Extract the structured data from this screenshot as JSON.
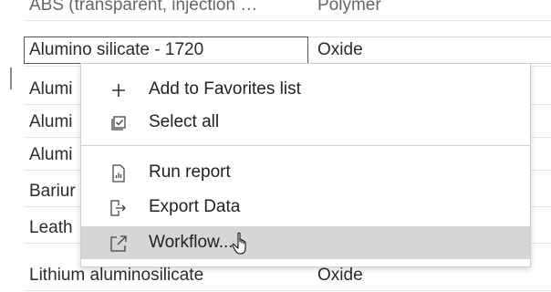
{
  "table": {
    "rows": [
      {
        "name": "ABS (transparent, injection …",
        "type": "Polymer"
      },
      {
        "name": "Alumino silicate - 1720",
        "type": "Oxide"
      },
      {
        "name": "Alumi",
        "type": ""
      },
      {
        "name": "Alumi",
        "type": ""
      },
      {
        "name": "Alumi",
        "type": ""
      },
      {
        "name": "Bariur",
        "type": ""
      },
      {
        "name": "Leath",
        "type": ""
      },
      {
        "name": "Lithium aluminosilicate",
        "type": "Oxide"
      }
    ]
  },
  "context_menu": {
    "items": [
      {
        "label": "Add to Favorites list",
        "icon": "plus-icon"
      },
      {
        "label": "Select all",
        "icon": "checkbox-checked-icon"
      },
      {
        "label": "Run report",
        "icon": "report-icon"
      },
      {
        "label": "Export Data",
        "icon": "export-icon"
      },
      {
        "label": "Workflow...",
        "icon": "external-link-icon"
      }
    ],
    "highlighted": "Workflow..."
  },
  "colors": {
    "highlight": "#d6d6d6",
    "border": "#cfcfcf",
    "text": "#222222"
  }
}
